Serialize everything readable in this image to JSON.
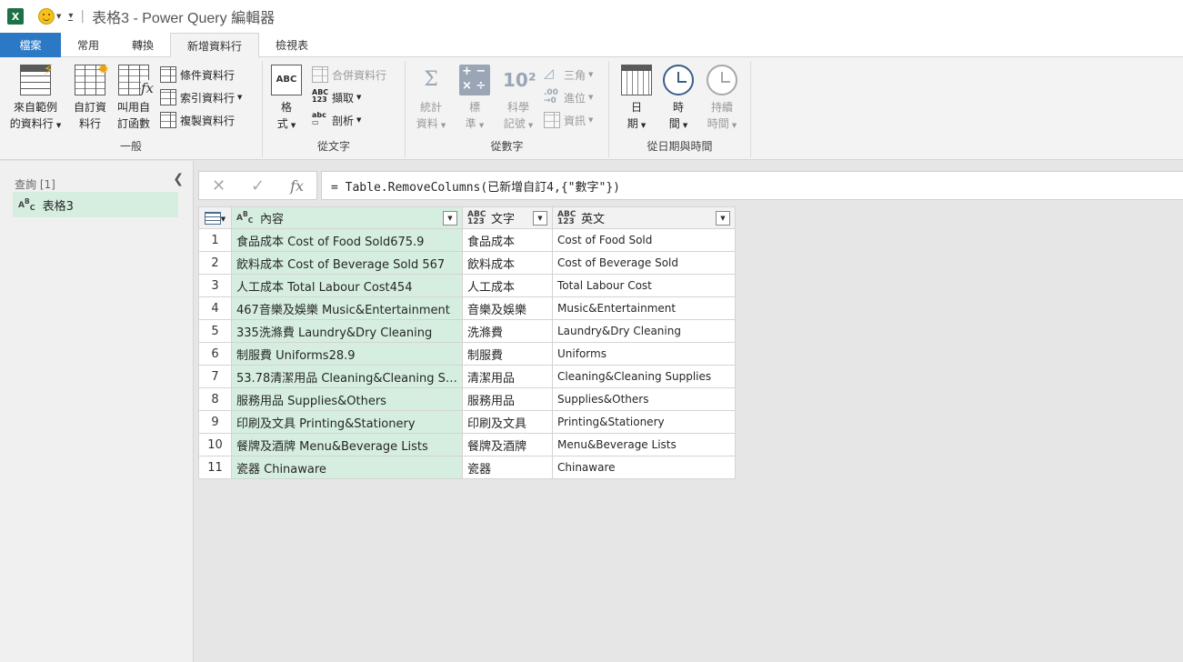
{
  "titlebar": {
    "app_icon": "excel-icon",
    "title": "表格3 - Power Query 編輯器"
  },
  "tabs": [
    {
      "label": "檔案"
    },
    {
      "label": "常用"
    },
    {
      "label": "轉換"
    },
    {
      "label": "新增資料行",
      "active": true
    },
    {
      "label": "檢視表"
    }
  ],
  "ribbon": {
    "general": {
      "label": "一般",
      "from_example": [
        "來自範例",
        "的資料行"
      ],
      "custom_column": [
        "自訂資",
        "料行"
      ],
      "invoke_function": [
        "叫用自",
        "訂函數"
      ],
      "conditional_column": "條件資料行",
      "index_column": "索引資料行",
      "duplicate_column": "複製資料行"
    },
    "from_text": {
      "label": "從文字",
      "format": [
        "格",
        "式"
      ],
      "merge_columns": "合併資料行",
      "extract": "擷取",
      "parse": "剖析"
    },
    "from_number": {
      "label": "從數字",
      "statistics": [
        "統計",
        "資料"
      ],
      "standard": [
        "標",
        "準"
      ],
      "scientific": [
        "科學",
        "記號"
      ],
      "trigonometry": "三角",
      "rounding": "進位",
      "information": "資訊"
    },
    "from_datetime": {
      "label": "從日期與時間",
      "date": [
        "日",
        "期"
      ],
      "time": [
        "時",
        "間"
      ],
      "duration": [
        "持續",
        "時間"
      ]
    }
  },
  "queries": {
    "title": "查詢 [1]",
    "items": [
      {
        "label": "表格3"
      }
    ]
  },
  "formula": {
    "text": "= Table.RemoveColumns(已新增自訂4,{\"數字\"})"
  },
  "table": {
    "columns": [
      {
        "type": "ABC",
        "name": "內容"
      },
      {
        "type": "ABC123",
        "name": "文字"
      },
      {
        "type": "ABC123",
        "name": "英文"
      }
    ],
    "rows": [
      {
        "n": "1",
        "c1": "食品成本 Cost of Food Sold675.9",
        "c2": "食品成本",
        "c3": "Cost of Food Sold"
      },
      {
        "n": "2",
        "c1": "飲料成本 Cost of Beverage Sold 567",
        "c2": "飲料成本",
        "c3": "Cost of Beverage Sold"
      },
      {
        "n": "3",
        "c1": "人工成本 Total Labour Cost454",
        "c2": "人工成本",
        "c3": "Total Labour Cost"
      },
      {
        "n": "4",
        "c1": "467音樂及娛樂 Music&Entertainment",
        "c2": "音樂及娛樂",
        "c3": "Music&Entertainment"
      },
      {
        "n": "5",
        "c1": "335洗滌費 Laundry&Dry Cleaning",
        "c2": "洗滌費",
        "c3": "Laundry&Dry Cleaning"
      },
      {
        "n": "6",
        "c1": "制服費 Uniforms28.9",
        "c2": "制服費",
        "c3": "Uniforms"
      },
      {
        "n": "7",
        "c1": "53.78清潔用品 Cleaning&Cleaning Suppl...",
        "c2": "清潔用品",
        "c3": "Cleaning&Cleaning Supplies"
      },
      {
        "n": "8",
        "c1": "服務用品 Supplies&Others",
        "c2": "服務用品",
        "c3": "Supplies&Others"
      },
      {
        "n": "9",
        "c1": "印刷及文具 Printing&Stationery",
        "c2": "印刷及文具",
        "c3": "Printing&Stationery"
      },
      {
        "n": "10",
        "c1": "餐牌及酒牌 Menu&Beverage Lists",
        "c2": "餐牌及酒牌",
        "c3": "Menu&Beverage Lists"
      },
      {
        "n": "11",
        "c1": "瓷器 Chinaware",
        "c2": "瓷器",
        "c3": "Chinaware"
      }
    ]
  },
  "colors": {
    "accent": "#2b78c5",
    "selected_column": "#d5eee0"
  }
}
